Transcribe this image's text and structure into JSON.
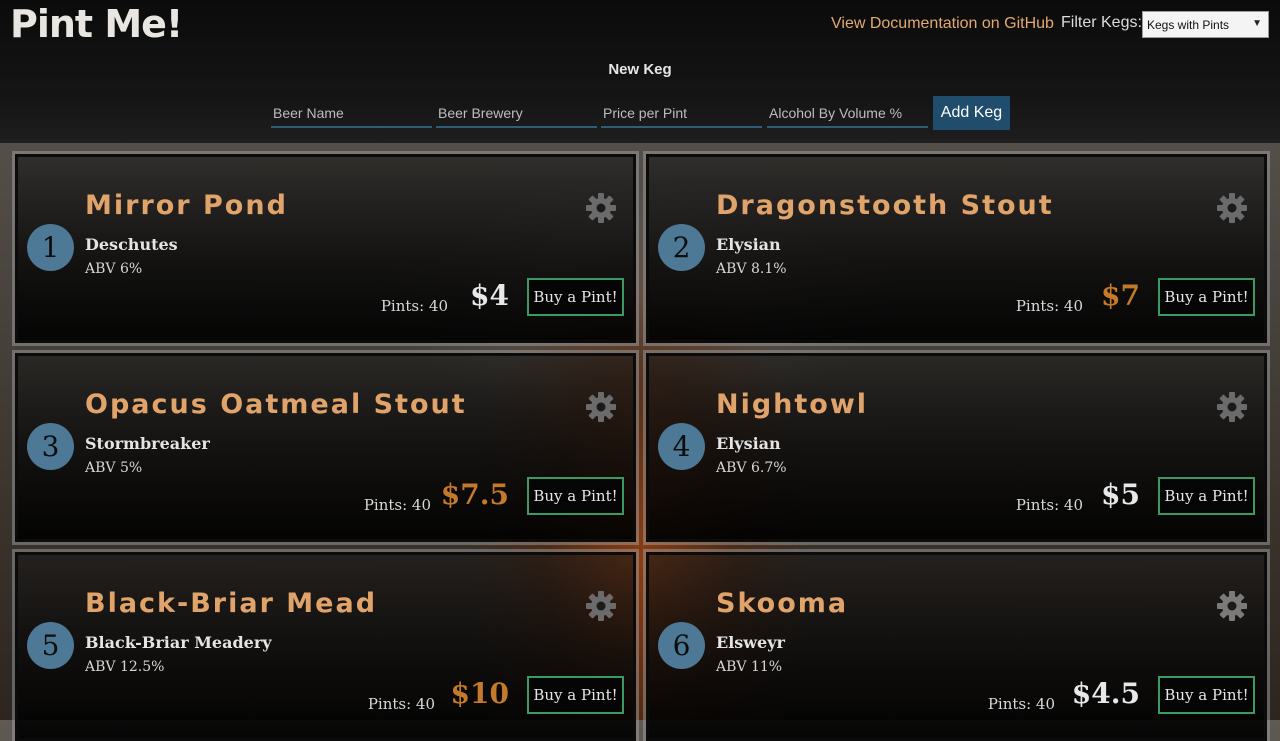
{
  "header": {
    "logo": "Pint Me!",
    "doc_link": "View Documentation on GitHub",
    "filter_label": "Filter Kegs:",
    "filter_value": "Kegs with Pints"
  },
  "new_keg": {
    "title": "New Keg",
    "name_placeholder": "Beer Name",
    "brewery_placeholder": "Beer Brewery",
    "price_placeholder": "Price per Pint",
    "abv_placeholder": "Alcohol By Volume %",
    "add_label": "Add Keg"
  },
  "colors": {
    "price_light": "#e8e8e8",
    "price_orange": "#c47a2a",
    "accent_blue": "#4d7896",
    "button_green": "#3b9a63",
    "name_orange": "#e0a46b"
  },
  "kegs": [
    {
      "tap": "1",
      "name": "Mirror Pond",
      "brewery": "Deschutes",
      "abv": "ABV 6%",
      "pints": "Pints: 40",
      "price": "$4",
      "price_color": "light",
      "buy_label": "Buy a Pint!"
    },
    {
      "tap": "2",
      "name": "Dragonstooth Stout",
      "brewery": "Elysian",
      "abv": "ABV 8.1%",
      "pints": "Pints: 40",
      "price": "$7",
      "price_color": "orange",
      "buy_label": "Buy a Pint!"
    },
    {
      "tap": "3",
      "name": "Opacus Oatmeal Stout",
      "brewery": "Stormbreaker",
      "abv": "ABV 5%",
      "pints": "Pints: 40",
      "price": "$7.5",
      "price_color": "orange",
      "buy_label": "Buy a Pint!"
    },
    {
      "tap": "4",
      "name": "Nightowl",
      "brewery": "Elysian",
      "abv": "ABV 6.7%",
      "pints": "Pints: 40",
      "price": "$5",
      "price_color": "light",
      "buy_label": "Buy a Pint!"
    },
    {
      "tap": "5",
      "name": "Black-Briar Mead",
      "brewery": "Black-Briar Meadery",
      "abv": "ABV 12.5%",
      "pints": "Pints: 40",
      "price": "$10",
      "price_color": "orange",
      "buy_label": "Buy a Pint!"
    },
    {
      "tap": "6",
      "name": "Skooma",
      "brewery": "Elsweyr",
      "abv": "ABV 11%",
      "pints": "Pints: 40",
      "price": "$4.5",
      "price_color": "light",
      "buy_label": "Buy a Pint!"
    }
  ]
}
